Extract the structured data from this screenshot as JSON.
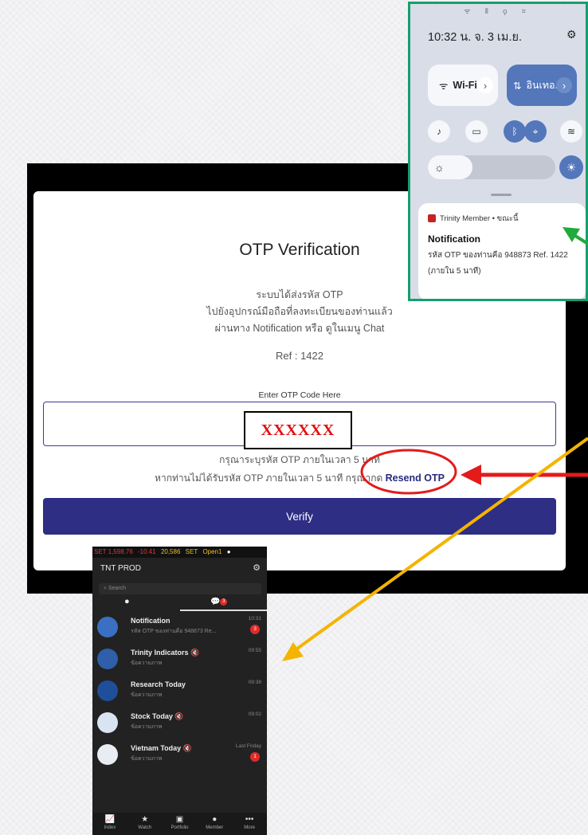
{
  "otp": {
    "title": "OTP Verification",
    "message_line1": "ระบบได้ส่งรหัส OTP",
    "message_line2": "ไปยังอุปกรณ์มือถือที่ลงทะเบียนของท่านแล้ว",
    "message_line3": "ผ่านทาง Notification หรือ ดูในเมนู Chat",
    "ref": "Ref :  1422",
    "input_label": "Enter OTP Code Here",
    "otp_value": "XXXXXX",
    "note_line1": "กรุณาระบุรหัส OTP ภายในเวลา 5 นาที",
    "note_line2_prefix": "หากท่านไม่ได้รับรหัส OTP ภายในเวลา 5 นาที กรุณากด ",
    "resend_label": "Resend OTP",
    "verify_label": "Verify"
  },
  "notification_panel": {
    "status_icons": "ᯤ ⦀ ⚲ ⌗",
    "time_date": "10:32 น.  จ. 3 เม.ย.",
    "settings_icon": "settings-icon",
    "wifi_label": "Wi-Fi",
    "data_label": "อินเทอ..",
    "notification": {
      "app": "Trinity Member • ขณะนี้",
      "title": "Notification",
      "body_line1": "รหัส OTP ของท่านคือ 948873 Ref. 1422",
      "body_line2": "(ภายใน 5 นาที)"
    }
  },
  "phone": {
    "ticker": {
      "set_label": "SET 1,598.76",
      "change": "-10.41",
      "volume": "20,586",
      "set2": "SET",
      "status": "Open1"
    },
    "title": "TNT PROD",
    "search_placeholder": "Search",
    "chats": [
      {
        "name": "Notification",
        "preview": "รหัส OTP ของท่านคือ 948873 Re...",
        "time": "10:31",
        "badge": "3"
      },
      {
        "name": "Trinity Indicators",
        "preview": "ข้อความภาพ",
        "time": "09:55",
        "badge": ""
      },
      {
        "name": "Research Today",
        "preview": "ข้อความภาพ",
        "time": "09:38",
        "badge": ""
      },
      {
        "name": "Stock Today",
        "preview": "ข้อความภาพ",
        "time": "09:02",
        "badge": ""
      },
      {
        "name": "Vietnam Today",
        "preview": "ข้อความภาพ",
        "time": "Last Friday",
        "badge": "1"
      }
    ],
    "nav": [
      "Index",
      "Watch",
      "Portfolio",
      "Member",
      "More"
    ]
  },
  "colors": {
    "primary": "#2d2e84",
    "highlight_red": "#e01010",
    "panel_border": "#169e6e",
    "arrow_green": "#1faa3c",
    "arrow_red": "#e31b1b",
    "arrow_yellow": "#f4b400"
  }
}
